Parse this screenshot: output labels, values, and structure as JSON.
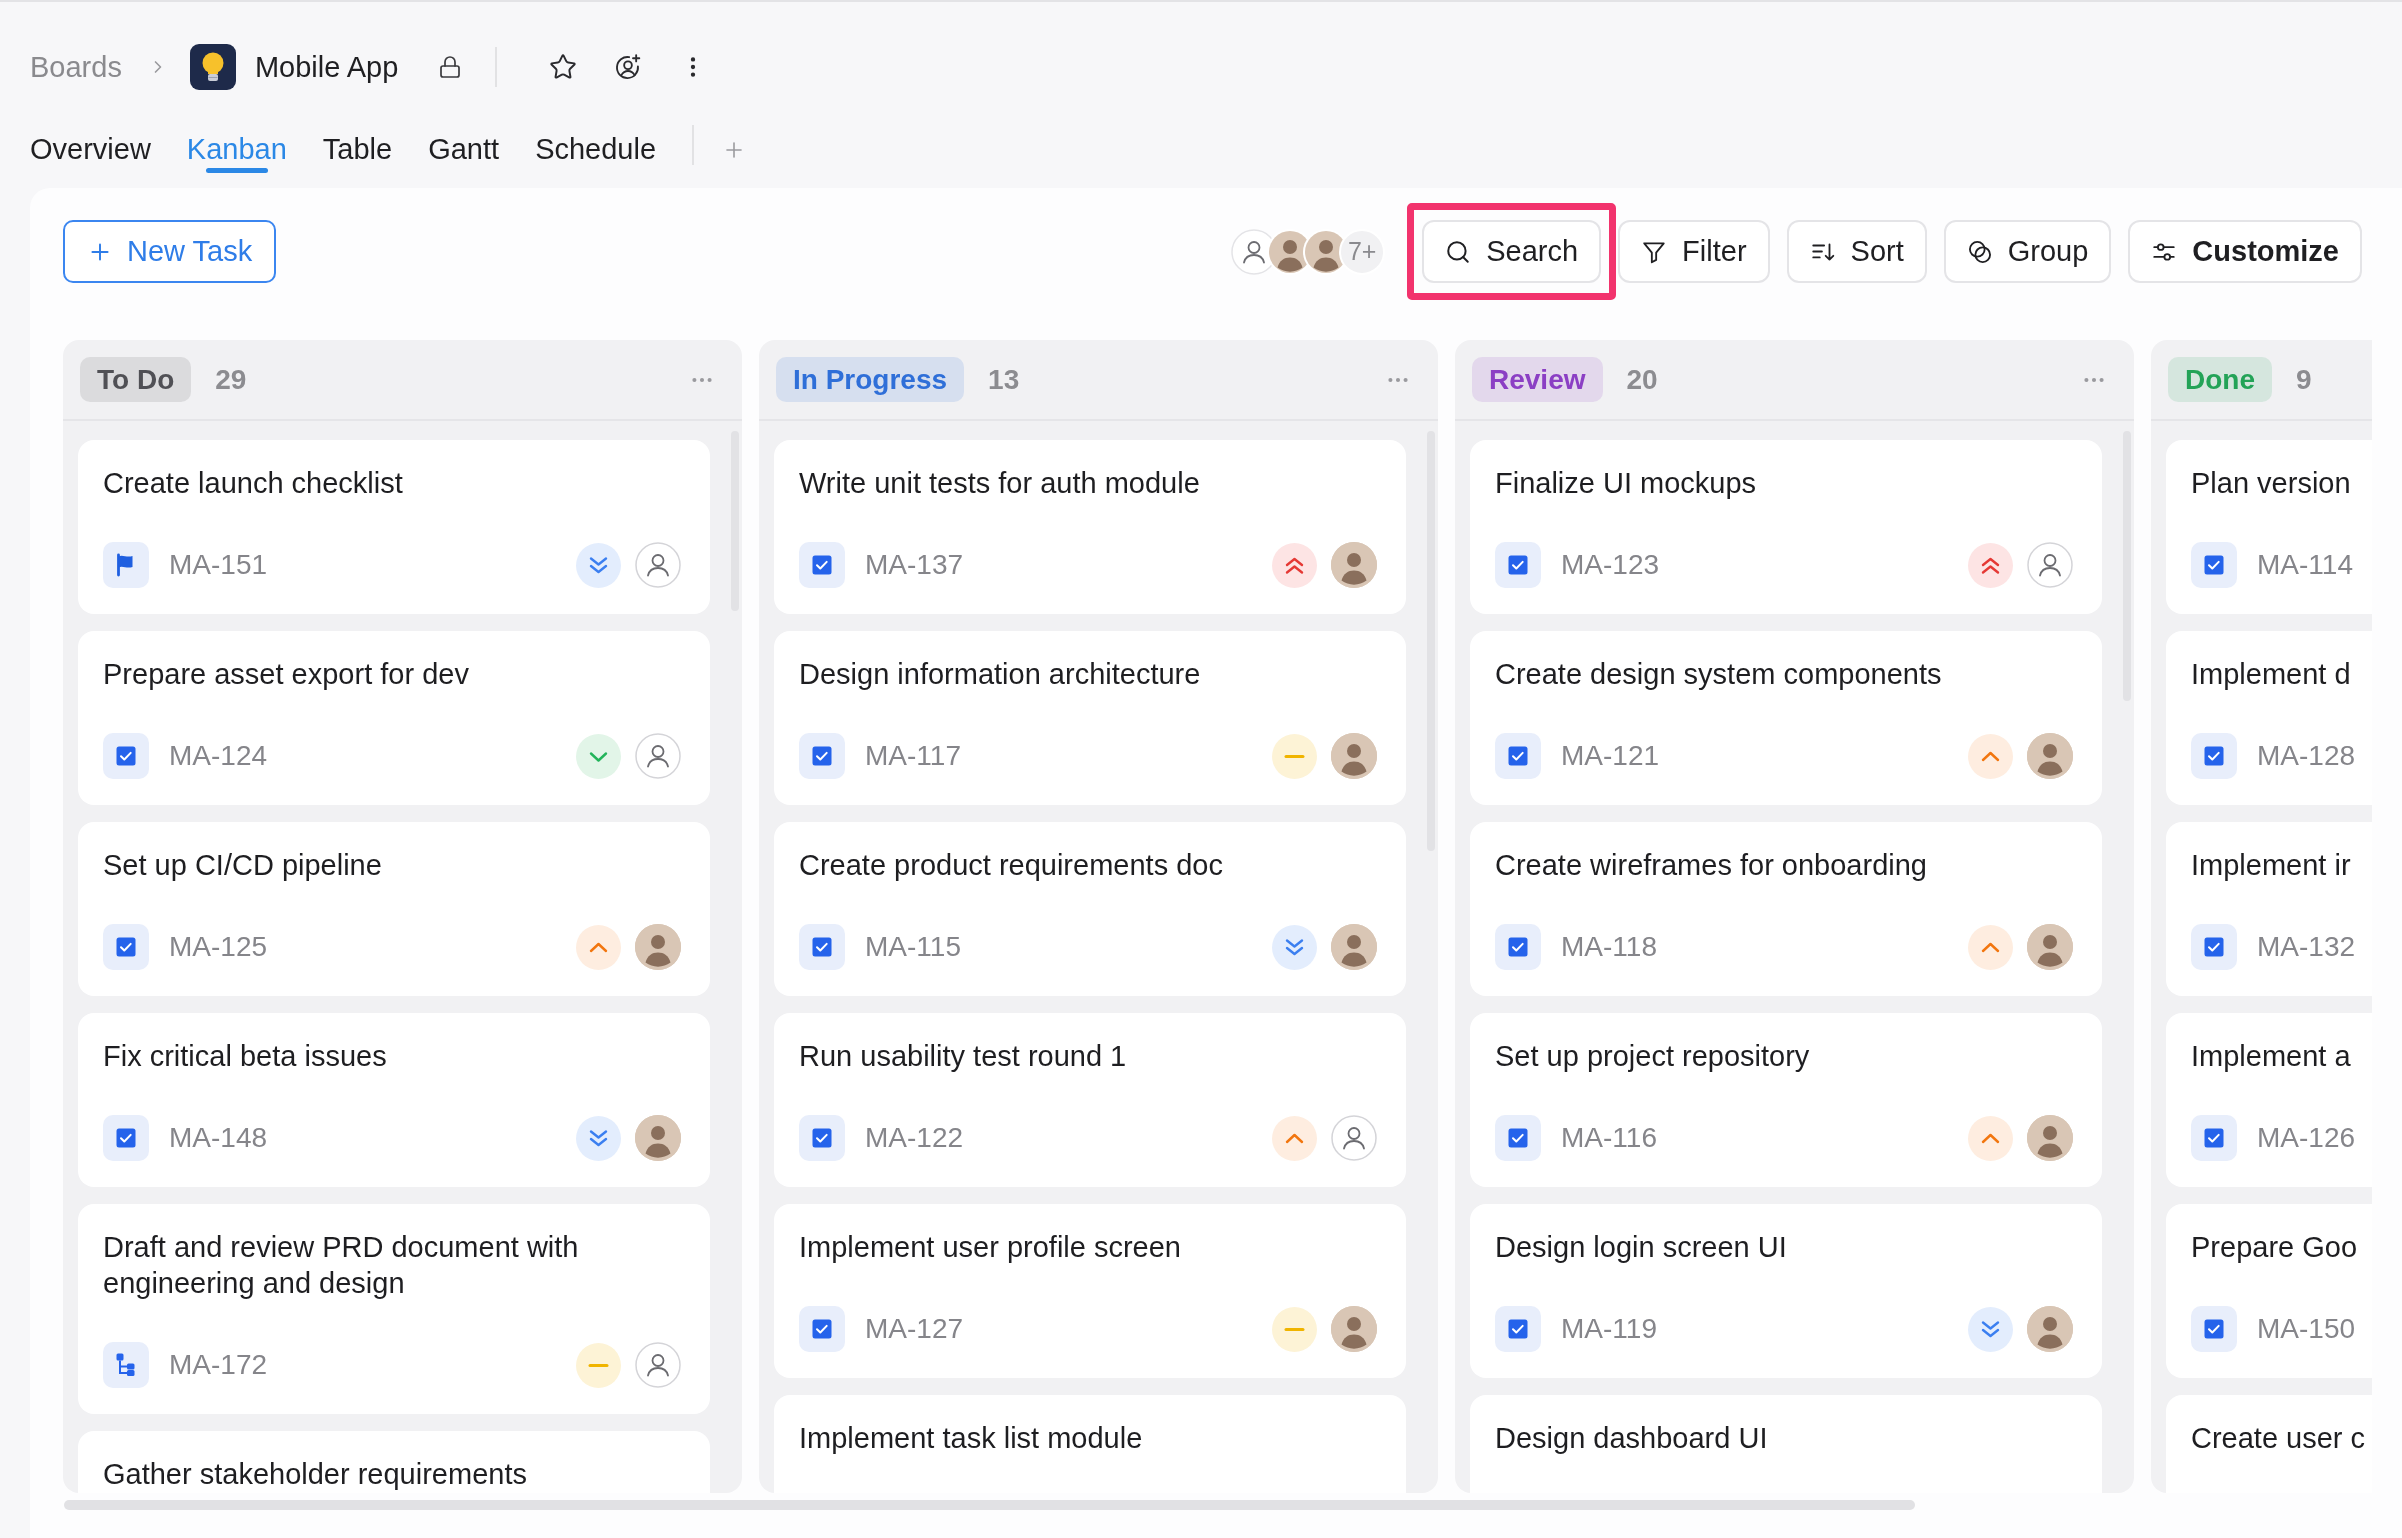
{
  "breadcrumb": {
    "parent": "Boards",
    "current": "Mobile App"
  },
  "tabs": [
    {
      "label": "Overview",
      "selected": false
    },
    {
      "label": "Kanban",
      "selected": true
    },
    {
      "label": "Table",
      "selected": false
    },
    {
      "label": "Gantt",
      "selected": false
    },
    {
      "label": "Schedule",
      "selected": false
    }
  ],
  "toolbar": {
    "new_task": "New Task",
    "members": [
      {
        "kind": "none"
      },
      {
        "kind": "photo"
      },
      {
        "kind": "photo"
      }
    ],
    "members_more": "7+",
    "buttons": [
      {
        "kind": "search",
        "label": "Search",
        "bold": false,
        "highlighted": true
      },
      {
        "kind": "filter",
        "label": "Filter",
        "bold": false,
        "highlighted": false
      },
      {
        "kind": "sort",
        "label": "Sort",
        "bold": false,
        "highlighted": false
      },
      {
        "kind": "group",
        "label": "Group",
        "bold": false,
        "highlighted": false
      },
      {
        "kind": "customize",
        "label": "Customize",
        "bold": true,
        "highlighted": false
      }
    ]
  },
  "columns": [
    {
      "title": "To Do",
      "count": "29",
      "color": "#505055",
      "cards": [
        {
          "title": "Create launch checklist",
          "id": "MA-151",
          "type": {
            "kind": "flag"
          },
          "priority": {
            "kind": "lowest"
          },
          "assignee": {
            "kind": "none"
          }
        },
        {
          "title": "Prepare asset export for dev",
          "id": "MA-124",
          "type": {
            "kind": "task"
          },
          "priority": {
            "kind": "low"
          },
          "assignee": {
            "kind": "none"
          }
        },
        {
          "title": "Set up CI/CD pipeline",
          "id": "MA-125",
          "type": {
            "kind": "task"
          },
          "priority": {
            "kind": "high"
          },
          "assignee": {
            "kind": "photo"
          }
        },
        {
          "title": "Fix critical beta issues",
          "id": "MA-148",
          "type": {
            "kind": "task"
          },
          "priority": {
            "kind": "lowest"
          },
          "assignee": {
            "kind": "photo"
          }
        },
        {
          "title": "Draft and review PRD document with engineering and design",
          "id": "MA-172",
          "type": {
            "kind": "subtask"
          },
          "priority": {
            "kind": "medium"
          },
          "assignee": {
            "kind": "none"
          }
        },
        {
          "title": "Gather stakeholder requirements"
        }
      ]
    },
    {
      "title": "In Progress",
      "count": "13",
      "color": "#2f6fd8",
      "cards": [
        {
          "title": "Write unit tests for auth module",
          "id": "MA-137",
          "type": {
            "kind": "task"
          },
          "priority": {
            "kind": "highest"
          },
          "assignee": {
            "kind": "photo"
          }
        },
        {
          "title": "Design information architecture",
          "id": "MA-117",
          "type": {
            "kind": "task"
          },
          "priority": {
            "kind": "medium"
          },
          "assignee": {
            "kind": "photo"
          }
        },
        {
          "title": "Create product requirements doc",
          "id": "MA-115",
          "type": {
            "kind": "task"
          },
          "priority": {
            "kind": "lowest"
          },
          "assignee": {
            "kind": "photo"
          }
        },
        {
          "title": "Run usability test round 1",
          "id": "MA-122",
          "type": {
            "kind": "task"
          },
          "priority": {
            "kind": "high"
          },
          "assignee": {
            "kind": "none"
          }
        },
        {
          "title": "Implement user profile screen",
          "id": "MA-127",
          "type": {
            "kind": "task"
          },
          "priority": {
            "kind": "medium"
          },
          "assignee": {
            "kind": "photo"
          }
        },
        {
          "title": "Implement task list module"
        }
      ]
    },
    {
      "title": "Review",
      "count": "20",
      "color": "#8b3fc4",
      "cards": [
        {
          "title": "Finalize UI mockups",
          "id": "MA-123",
          "type": {
            "kind": "task"
          },
          "priority": {
            "kind": "highest"
          },
          "assignee": {
            "kind": "none"
          }
        },
        {
          "title": "Create design system components",
          "id": "MA-121",
          "type": {
            "kind": "task"
          },
          "priority": {
            "kind": "high"
          },
          "assignee": {
            "kind": "photo"
          }
        },
        {
          "title": "Create wireframes for onboarding",
          "id": "MA-118",
          "type": {
            "kind": "task"
          },
          "priority": {
            "kind": "high"
          },
          "assignee": {
            "kind": "photo"
          }
        },
        {
          "title": "Set up project repository",
          "id": "MA-116",
          "type": {
            "kind": "task"
          },
          "priority": {
            "kind": "high"
          },
          "assignee": {
            "kind": "photo"
          }
        },
        {
          "title": "Design login screen UI",
          "id": "MA-119",
          "type": {
            "kind": "task"
          },
          "priority": {
            "kind": "lowest"
          },
          "assignee": {
            "kind": "photo"
          }
        },
        {
          "title": "Design dashboard UI"
        }
      ]
    },
    {
      "title": "Done",
      "count": "9",
      "color": "#23a357",
      "cards": [
        {
          "title": "Plan version",
          "id": "MA-114",
          "type": {
            "kind": "task"
          }
        },
        {
          "title": "Implement d",
          "id": "MA-128",
          "type": {
            "kind": "task"
          }
        },
        {
          "title": "Implement ir",
          "id": "MA-132",
          "type": {
            "kind": "task"
          }
        },
        {
          "title": "Implement a",
          "id": "MA-126",
          "type": {
            "kind": "task"
          }
        },
        {
          "title": "Prepare Goo",
          "id": "MA-150",
          "type": {
            "kind": "task"
          }
        },
        {
          "title": "Create user c"
        }
      ]
    }
  ]
}
